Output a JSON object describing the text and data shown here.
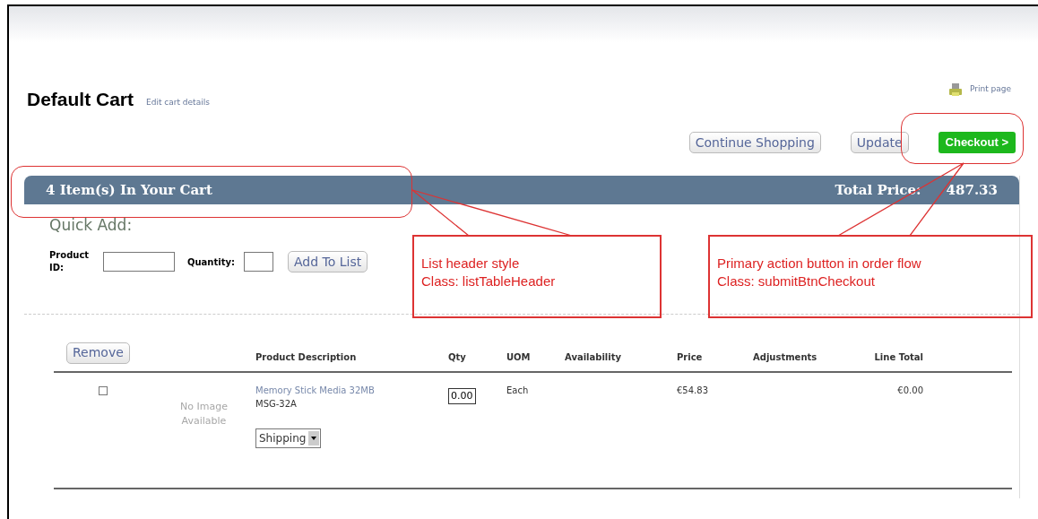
{
  "page": {
    "title": "Default Cart",
    "edit_link": "Edit cart details",
    "print_link": "Print page"
  },
  "actions": [
    {
      "label": "Continue Shopping",
      "kind": "secondary"
    },
    {
      "label": "Update",
      "kind": "secondary"
    },
    {
      "label": "Checkout >",
      "kind": "primary"
    }
  ],
  "cart_header": {
    "count": "4 Item(s) In Your Cart",
    "total_label": "Total Price:",
    "total_value": "487.33"
  },
  "quick_add": {
    "title": "Quick Add:",
    "product_id_label": "Product ID:",
    "quantity_label": "Quantity:",
    "button": "Add To List"
  },
  "remove_button": "Remove",
  "table": {
    "columns": [
      "Product Description",
      "Qty",
      "UOM",
      "Availability",
      "Price",
      "Adjustments",
      "Line Total"
    ],
    "rows": [
      {
        "checked": false,
        "image_text": "No Image Available",
        "name": "Memory Stick Media 32MB",
        "sku": "MSG-32A",
        "qty": "0.00",
        "uom": "Each",
        "price": "€54.83",
        "line_total": "€0.00",
        "fulfillment": "Shipping"
      }
    ]
  },
  "annotations": [
    {
      "lines": [
        "List header style",
        "Class: listTableHeader"
      ]
    },
    {
      "lines": [
        "Primary action button in order flow",
        "Class: submitBtnCheckout"
      ]
    }
  ]
}
